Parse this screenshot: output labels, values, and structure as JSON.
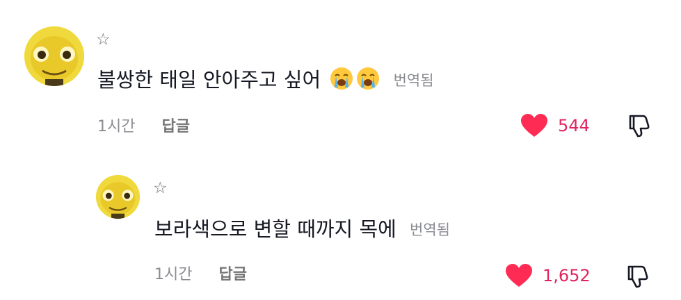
{
  "comments": [
    {
      "star": "☆",
      "text": "불쌍한 태일 안아주고 싶어",
      "emoji": [
        "crying-face",
        "crying-face"
      ],
      "translated_label": "번역됨",
      "time": "1시간",
      "reply_label": "답글",
      "like_count": "544"
    },
    {
      "star": "☆",
      "text": "보라색으로 변할 때까지 목에",
      "translated_label": "번역됨",
      "time": "1시간",
      "reply_label": "답글",
      "like_count": "1,652"
    }
  ],
  "colors": {
    "heart": "#fe2c55",
    "like_count": "#e0245e",
    "meta": "#8a8b91",
    "avatar": "#f4e04a"
  },
  "icons": [
    "star-icon",
    "heart-icon",
    "dislike-icon",
    "crying-face-emoji"
  ]
}
